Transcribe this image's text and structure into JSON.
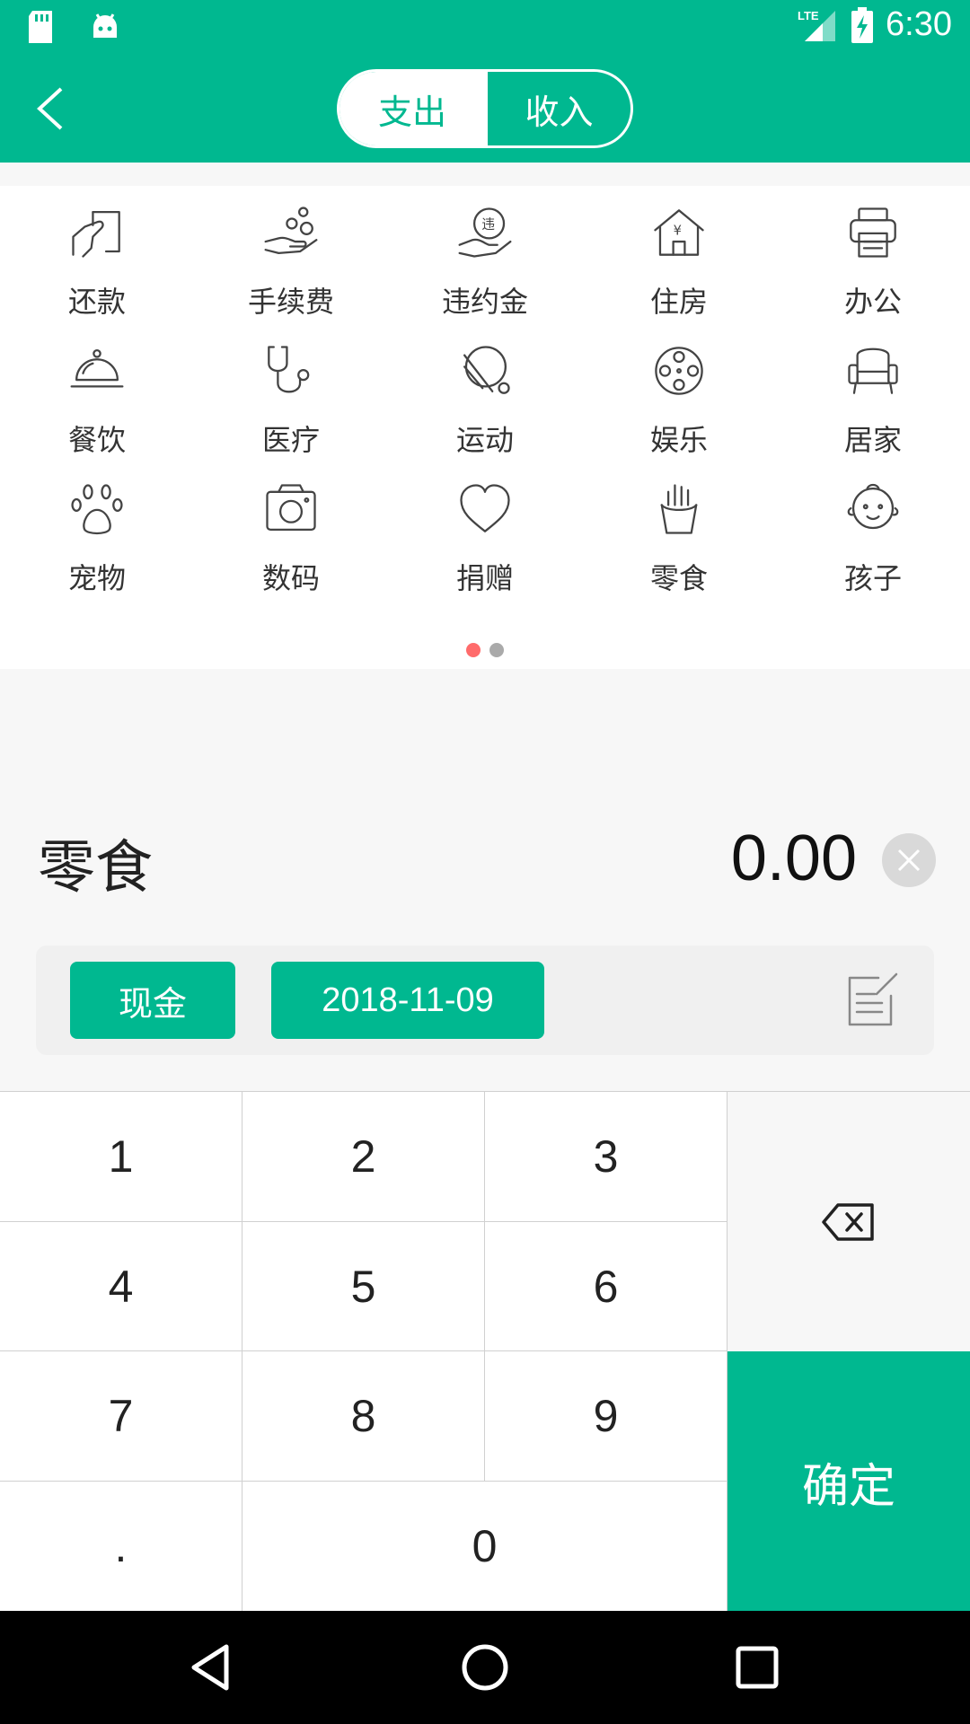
{
  "status": {
    "time": "6:30",
    "network": "LTE"
  },
  "header": {
    "tabs": [
      {
        "label": "支出",
        "active": true
      },
      {
        "label": "收入",
        "active": false
      }
    ]
  },
  "categories": [
    {
      "label": "还款",
      "icon": "repayment-icon"
    },
    {
      "label": "手续费",
      "icon": "fee-icon"
    },
    {
      "label": "违约金",
      "icon": "penalty-icon"
    },
    {
      "label": "住房",
      "icon": "house-icon"
    },
    {
      "label": "办公",
      "icon": "printer-icon"
    },
    {
      "label": "餐饮",
      "icon": "dish-icon"
    },
    {
      "label": "医疗",
      "icon": "stethoscope-icon"
    },
    {
      "label": "运动",
      "icon": "pingpong-icon"
    },
    {
      "label": "娱乐",
      "icon": "film-reel-icon"
    },
    {
      "label": "居家",
      "icon": "armchair-icon"
    },
    {
      "label": "宠物",
      "icon": "paw-icon"
    },
    {
      "label": "数码",
      "icon": "camera-icon"
    },
    {
      "label": "捐赠",
      "icon": "heart-icon"
    },
    {
      "label": "零食",
      "icon": "fries-icon"
    },
    {
      "label": "孩子",
      "icon": "baby-icon"
    }
  ],
  "pager": {
    "current": 1,
    "total": 2
  },
  "entry": {
    "category": "零食",
    "amount": "0.00",
    "account": "现金",
    "date": "2018-11-09"
  },
  "keypad": {
    "keys": [
      "1",
      "2",
      "3",
      "4",
      "5",
      "6",
      "7",
      "8",
      "9",
      ".",
      "0"
    ],
    "confirm": "确定"
  },
  "colors": {
    "accent": "#00b890",
    "dot_active": "#ff6b6b",
    "dot_inactive": "#aaaaaa"
  }
}
